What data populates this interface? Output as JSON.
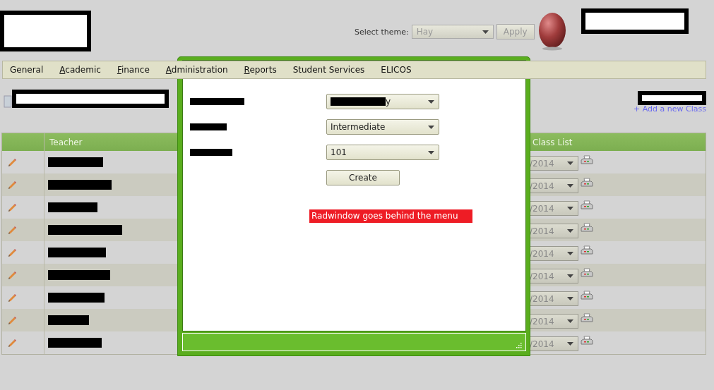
{
  "header": {
    "theme_label": "Select theme:",
    "theme_select": {
      "value": "Hay",
      "disabled": true
    },
    "apply_button": {
      "label": "Apply",
      "disabled": true
    }
  },
  "menu": [
    {
      "label": "General",
      "access_key": false
    },
    {
      "label": "Academic",
      "access_key": true
    },
    {
      "label": "Finance",
      "access_key": true
    },
    {
      "label": "Administration",
      "access_key": true
    },
    {
      "label": "Reports",
      "access_key": true
    },
    {
      "label": "Student Services",
      "access_key": false
    },
    {
      "label": "ELICOS",
      "access_key": false
    }
  ],
  "page": {
    "add_link": "+ Add a new Class"
  },
  "table": {
    "columns": [
      {
        "label": "Teacher"
      },
      {
        "label": "Class List"
      }
    ],
    "rows": [
      {
        "class_list": "/2014"
      },
      {
        "class_list": "/2014"
      },
      {
        "class_list": "/2014"
      },
      {
        "class_list": "/2014"
      },
      {
        "class_list": "/2014"
      },
      {
        "class_list": "/2014"
      },
      {
        "class_list": "/2014"
      },
      {
        "class_list": "/2014"
      },
      {
        "class_list": "/2014"
      }
    ]
  },
  "dialog": {
    "fields": [
      {
        "redacted": true,
        "value": "y"
      },
      {
        "redacted": false,
        "value": "Intermediate"
      },
      {
        "redacted": false,
        "value": "101"
      }
    ],
    "create_button": "Create",
    "note": "Radwindow goes behind the menu"
  }
}
